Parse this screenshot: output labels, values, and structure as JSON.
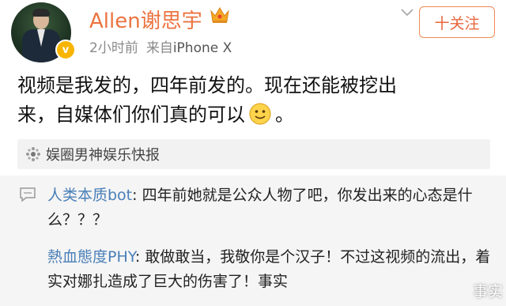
{
  "header": {
    "username": "Allen谢思宇",
    "time": "2小时前",
    "source_prefix": "来自",
    "device": "iPhone X",
    "follow_label": "十关注"
  },
  "post": {
    "text_line1": "视频是我发的，四年前发的。现在还能被挖出",
    "text_line2_before": "来，自媒体们你们真的可以",
    "text_line2_after": "。"
  },
  "source_tag": {
    "label": "娱圈男神娱乐快报"
  },
  "comments": [
    {
      "user": "人类本质bot",
      "text": ": 四年前她就是公众人物了吧，你发出来的心态是什么？？？"
    },
    {
      "user": "熱血態度PHY",
      "text": ": 敢做敢当，我敬你是个汉子！不过这视频的流出，着实对娜扎造成了巨大的伤害了！事实"
    }
  ],
  "watermark": {
    "text": "事实"
  },
  "colors": {
    "username": "#eb7340",
    "follow_border": "#f08a55",
    "comment_user": "#4a7fb8",
    "vip_badge": "#f7b500"
  },
  "icons": {
    "crown": "crown-icon",
    "chevron": "chevron-down-icon",
    "source": "weibo-tag-icon",
    "comment": "comment-icon"
  }
}
